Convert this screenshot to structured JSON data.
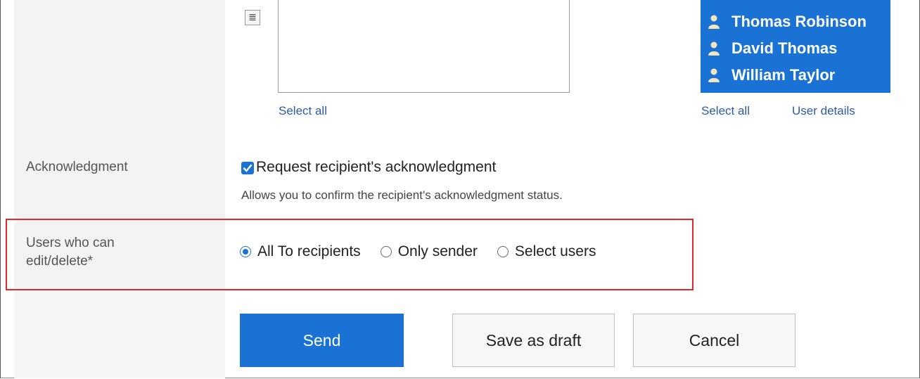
{
  "recipients": {
    "selected_users": [
      "Thomas Robinson",
      "David Thomas",
      "William Taylor"
    ],
    "candidates_select_all": "Select all",
    "selected_select_all": "Select all",
    "user_details": "User details",
    "editor_icon_glyph": "≣"
  },
  "acknowledgment": {
    "label": "Acknowledgment",
    "checkbox_label": "Request recipient's acknowledgment",
    "checked": true,
    "helper": "Allows you to confirm the recipient's acknowledgment status."
  },
  "permissions": {
    "label_line1": "Users who can",
    "label_line2": "edit/delete*",
    "options": [
      {
        "label": "All To recipients",
        "checked": true
      },
      {
        "label": "Only sender",
        "checked": false
      },
      {
        "label": "Select users",
        "checked": false
      }
    ]
  },
  "actions": {
    "send": "Send",
    "save_draft": "Save as draft",
    "cancel": "Cancel"
  },
  "colors": {
    "accent": "#1a73d4",
    "highlight": "#e02a2a",
    "link": "#2a5ba8"
  },
  "icons": {
    "user": "user-icon",
    "checkbox": "checkmark-icon"
  }
}
